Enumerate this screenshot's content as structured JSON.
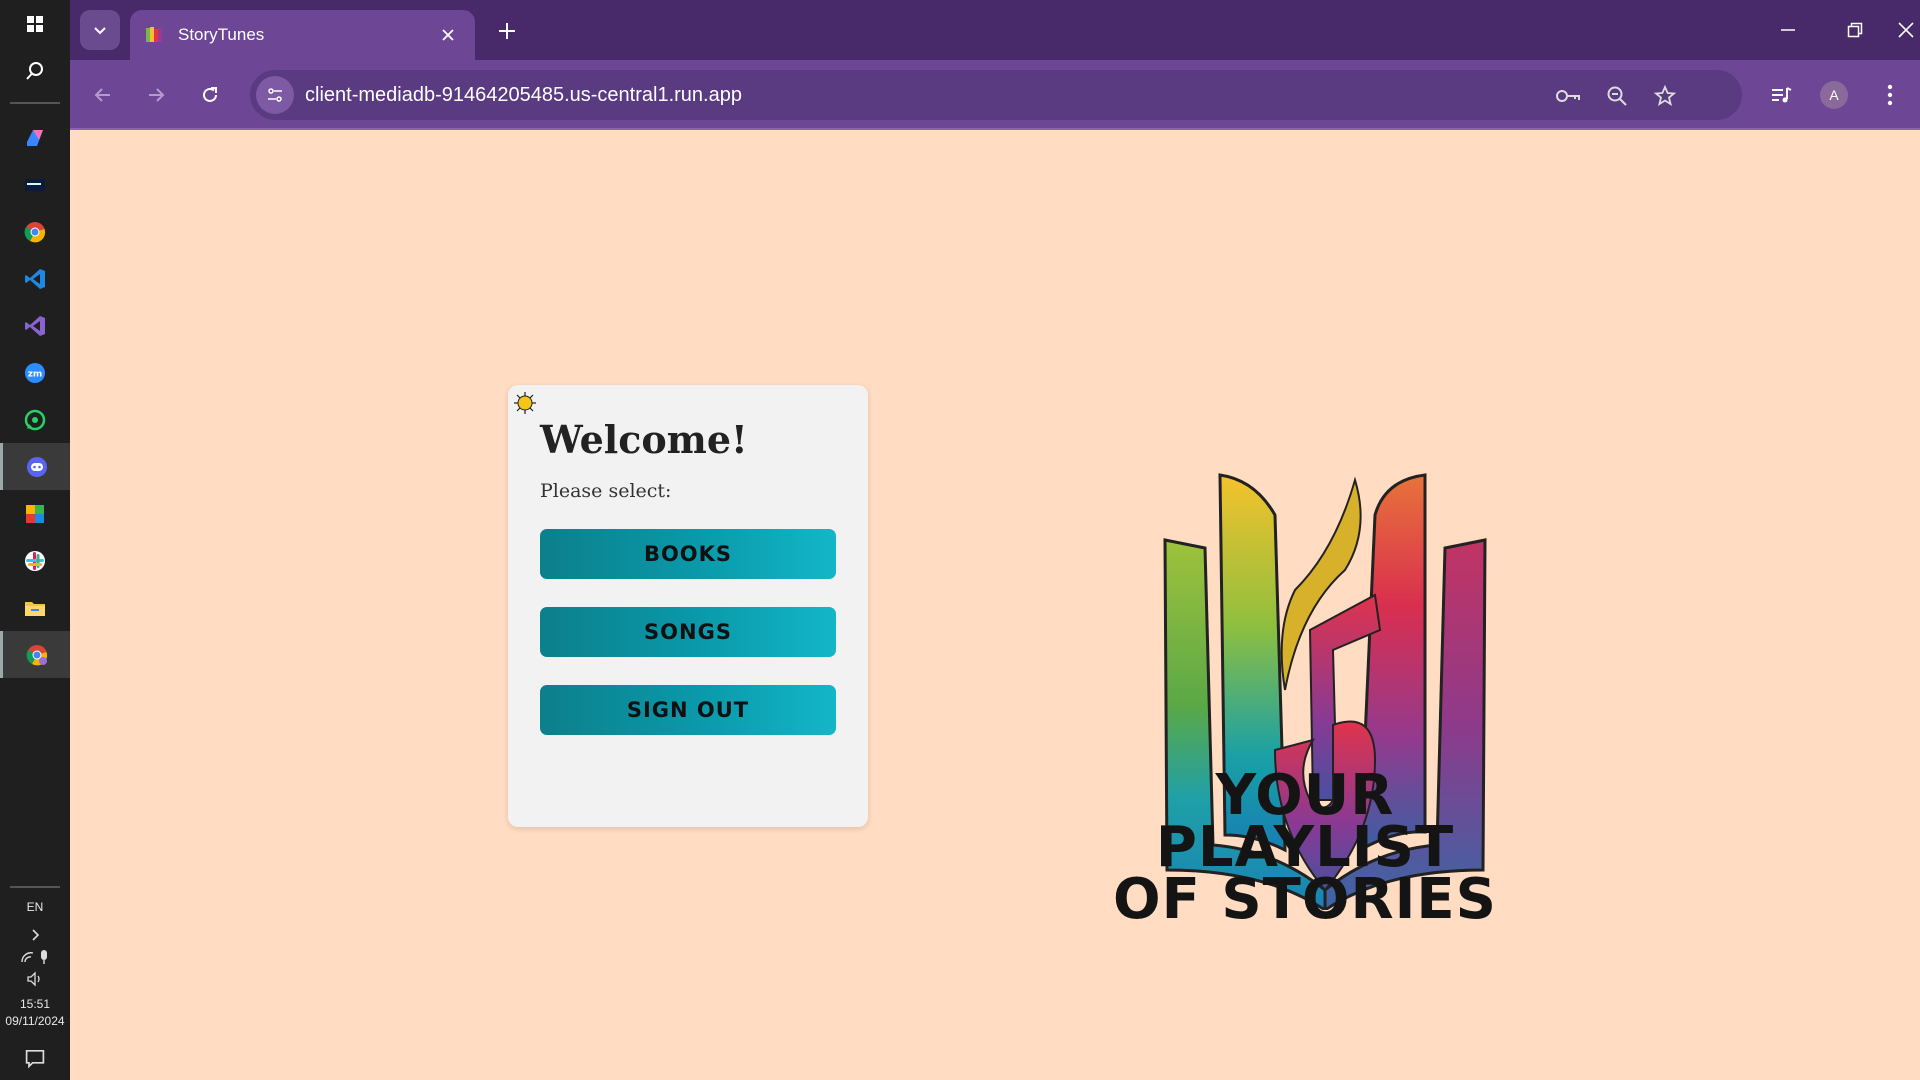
{
  "taskbar": {
    "apps": [
      "windows-icon",
      "search-icon",
      "copilot-icon",
      "mymedia-icon",
      "chrome-icon",
      "vscode-icon",
      "visual-studio-icon",
      "zoom-icon",
      "whatsapp-icon",
      "discord-icon",
      "paint-icon",
      "slack-icon",
      "file-explorer-icon",
      "chrome-profile-icon"
    ],
    "language": "EN",
    "time": "15:51",
    "date": "09/11/2024"
  },
  "browser": {
    "tab_title": "StoryTunes",
    "url": "client-mediadb-91464205485.us-central1.run.app",
    "profile_initial": "A"
  },
  "page": {
    "welcome": "Welcome!",
    "prompt": "Please select:",
    "buttons": {
      "books": "BOOKS",
      "songs": "SONGS",
      "sign_out": "SIGN OUT"
    },
    "tagline_line1": "YOUR PLAYLIST",
    "tagline_line2": "OF STORIES"
  },
  "colors": {
    "page_background": "#ffdcc2",
    "card_background": "#f2f2f2",
    "button_gradient_start": "#0c7f8b",
    "button_gradient_end": "#13b6c8",
    "browser_frame": "#48296a",
    "browser_toolbar": "#6d4696"
  }
}
